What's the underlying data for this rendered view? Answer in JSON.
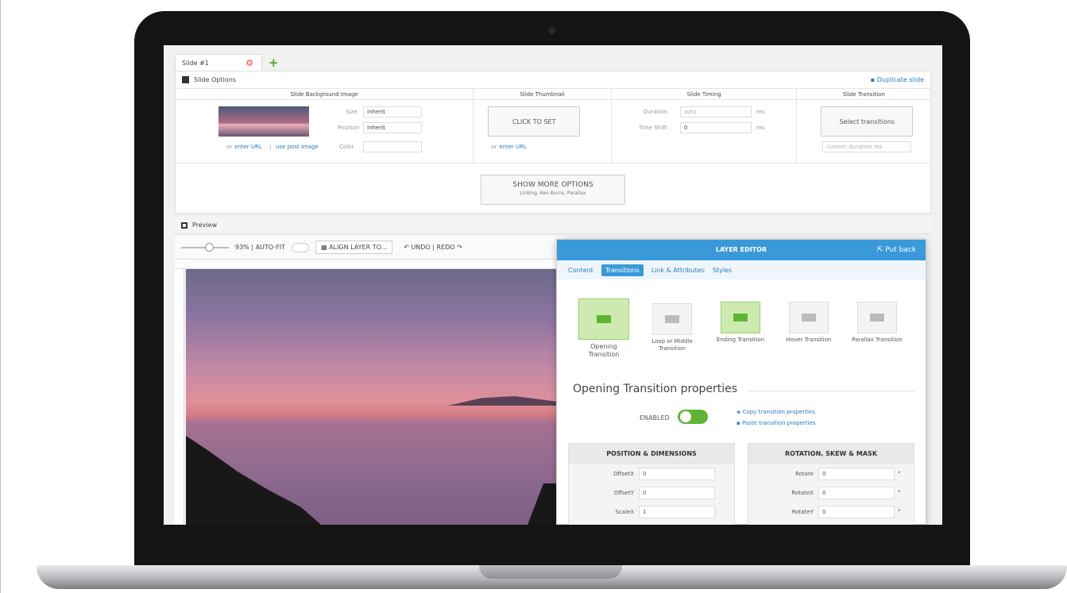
{
  "editor": {
    "tab_label": "Slide #1",
    "slide_options": "Slide Options",
    "duplicate_slide": "Duplicate slide",
    "columns": [
      "Slide Background Image",
      "Slide Thumbnail",
      "Slide Timing",
      "Slide Transition"
    ],
    "bg": {
      "size_label": "Size",
      "size_value": "Inherit",
      "position_label": "Position",
      "position_value": "Inherit",
      "color_label": "Color",
      "or_text": "or",
      "enter_url": "enter URL",
      "separator": "|",
      "use_post_image": "use post image"
    },
    "thumbnail": {
      "button": "CLICK TO SET",
      "or_text": "or",
      "enter_url": "enter URL"
    },
    "timing": {
      "duration_label": "Duration",
      "duration_value": "auto",
      "time_shift_label": "Time Shift",
      "time_shift_value": "0",
      "unit": "ms"
    },
    "transition": {
      "button": "Select transitions",
      "custom_duration": "custom duration",
      "unit": "ms"
    },
    "show_more": "SHOW MORE OPTIONS",
    "show_more_sub": "Linking, Ken Burns, Parallax",
    "preview": "Preview",
    "zoom": "93% | AUTO-FIT",
    "align": "ALIGN LAYER TO...",
    "undo_redo": "UNDO | REDO"
  },
  "layer_editor": {
    "title": "LAYER EDITOR",
    "put_back": "Put back",
    "tabs": [
      "Content",
      "Transitions",
      "Link & Attributes",
      "Styles"
    ],
    "transitions": [
      {
        "label": "Opening Transition",
        "active": true
      },
      {
        "label": "Loop or Middle Transition",
        "active": false
      },
      {
        "label": "Ending Transition",
        "active": true
      },
      {
        "label": "Hover Transition",
        "active": false
      },
      {
        "label": "Parallax Transition",
        "active": false
      }
    ],
    "properties_title": "Opening Transition properties",
    "enabled_label": "ENABLED",
    "copy_props": "Copy transition properties",
    "paste_props": "Paste transition properties",
    "position_section": {
      "title": "POSITION & DIMENSIONS",
      "rows": [
        {
          "label": "OffsetX",
          "value": "0"
        },
        {
          "label": "OffsetY",
          "value": "0"
        },
        {
          "label": "ScaleX",
          "value": "1"
        }
      ]
    },
    "rotation_section": {
      "title": "ROTATION, SKEW & MASK",
      "rows": [
        {
          "label": "Rotate",
          "value": "0"
        },
        {
          "label": "RotateX",
          "value": "0"
        },
        {
          "label": "RotateY",
          "value": "0"
        }
      ],
      "unit": "°"
    }
  },
  "colors": {
    "accent": "#3a9ad9",
    "toggle_on": "#5fb434"
  }
}
